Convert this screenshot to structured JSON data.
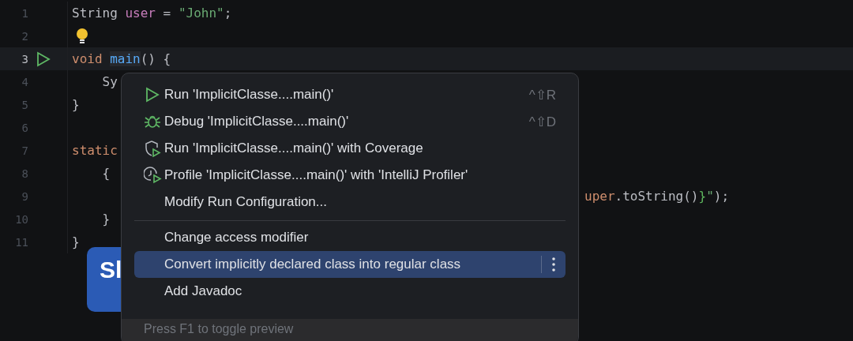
{
  "editor": {
    "lines": [
      {
        "number": "1",
        "tokens": [
          {
            "kind": "plain",
            "text": "String "
          },
          {
            "kind": "field",
            "text": "user"
          },
          {
            "kind": "plain",
            "text": " = "
          },
          {
            "kind": "string",
            "text": "\"John\""
          },
          {
            "kind": "plain",
            "text": ";"
          }
        ]
      },
      {
        "number": "2",
        "bulb": true
      },
      {
        "number": "3",
        "current": true,
        "run": true,
        "tokens": [
          {
            "kind": "keyword",
            "text": "void "
          },
          {
            "kind": "method",
            "text": "main"
          },
          {
            "kind": "plain",
            "text": "() {"
          }
        ]
      },
      {
        "number": "4",
        "tokens": [
          {
            "kind": "plain",
            "text": "    Sy"
          }
        ]
      },
      {
        "number": "5",
        "tokens": [
          {
            "kind": "plain",
            "text": "}"
          }
        ]
      },
      {
        "number": "6"
      },
      {
        "number": "7",
        "tokens": [
          {
            "kind": "keyword",
            "text": "static"
          }
        ]
      },
      {
        "number": "8",
        "tokens": [
          {
            "kind": "plain",
            "text": "    {"
          }
        ]
      },
      {
        "number": "9",
        "partial": true,
        "tokens": [
          {
            "kind": "keyword",
            "text": "uper"
          },
          {
            "kind": "plain",
            "text": ".toString()"
          },
          {
            "kind": "brace",
            "text": "}"
          },
          {
            "kind": "string",
            "text": "\""
          },
          {
            "kind": "plain",
            "text": ");"
          }
        ]
      },
      {
        "number": "10",
        "tokens": [
          {
            "kind": "plain",
            "text": "    }"
          }
        ]
      },
      {
        "number": "11",
        "tokens": [
          {
            "kind": "plain",
            "text": "}"
          }
        ]
      }
    ]
  },
  "overlay_button": {
    "text": "Sl"
  },
  "popup": {
    "groups": [
      [
        {
          "kind": "run",
          "label": "Run 'ImplicitClasse....main()'",
          "shortcut": "^⇧R",
          "selected": false
        },
        {
          "kind": "debug",
          "label": "Debug 'ImplicitClasse....main()'",
          "shortcut": "^⇧D",
          "selected": false
        },
        {
          "kind": "coverage",
          "label": "Run 'ImplicitClasse....main()' with Coverage",
          "selected": false
        },
        {
          "kind": "profile",
          "label": "Profile 'ImplicitClasse....main()' with 'IntelliJ Profiler'",
          "selected": false
        },
        {
          "kind": "plain",
          "label": "Modify Run Configuration...",
          "selected": false
        }
      ],
      [
        {
          "kind": "plain",
          "label": "Change access modifier",
          "selected": false
        },
        {
          "kind": "plain",
          "label": "Convert implicitly declared class into regular class",
          "selected": true
        },
        {
          "kind": "plain",
          "label": "Add Javadoc",
          "selected": false
        }
      ]
    ],
    "footer": "Press F1 to toggle preview"
  }
}
